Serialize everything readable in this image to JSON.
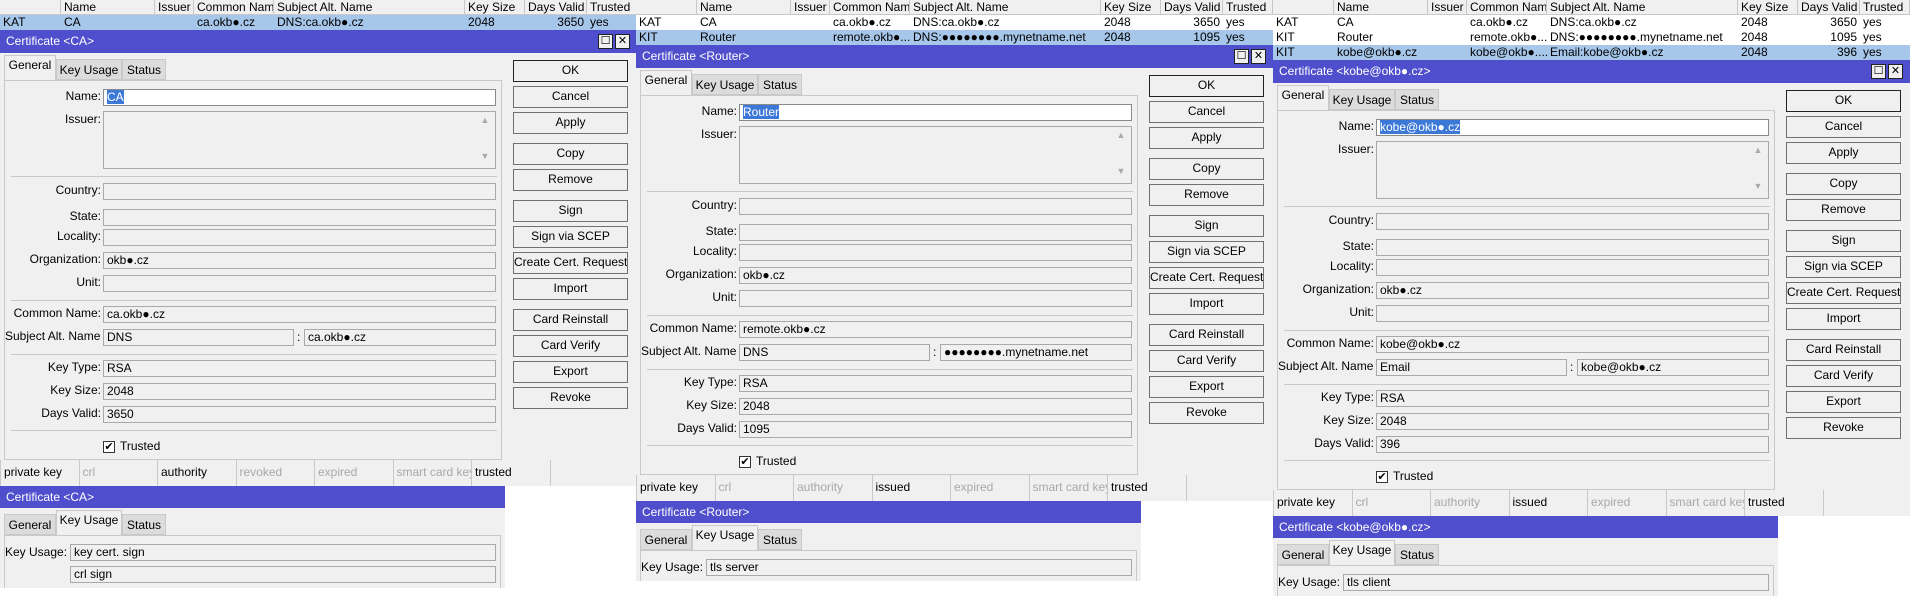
{
  "list_columns": [
    "",
    "Name",
    "Issuer",
    "Common Name",
    "Subject Alt. Name",
    "Key Size",
    "Days Valid",
    "Trusted"
  ],
  "list_rows": [
    [
      "KAT",
      "CA",
      "",
      "ca.okb●.cz",
      "DNS:ca.okb●.cz",
      "2048",
      "3650",
      "yes"
    ],
    [
      "KIT",
      "Router",
      "",
      "remote.okb●....",
      "DNS:●●●●●●●●.mynetname.net",
      "2048",
      "1095",
      "yes"
    ],
    [
      "KIT",
      "kobe@okb●.cz",
      "",
      "kobe@okb●....",
      "Email:kobe@okb●.cz",
      "2048",
      "396",
      "yes"
    ]
  ],
  "labels": {
    "name": "Name:",
    "issuer": "Issuer:",
    "country": "Country:",
    "state": "State:",
    "locality": "Locality:",
    "organization": "Organization:",
    "unit": "Unit:",
    "common_name": "Common Name:",
    "san": "Subject Alt. Name:",
    "key_type": "Key Type:",
    "key_size": "Key Size:",
    "days_valid": "Days Valid:",
    "trusted": "Trusted",
    "key_usage": "Key Usage:",
    "colon": ":"
  },
  "tabs": [
    "General",
    "Key Usage",
    "Status"
  ],
  "buttons": [
    "OK",
    "Cancel",
    "Apply",
    "Copy",
    "Remove",
    "Sign",
    "Sign via SCEP",
    "Create Cert. Request",
    "Import",
    "Card Reinstall",
    "Card Verify",
    "Export",
    "Revoke"
  ],
  "window_icons": [
    "maximize-icon",
    "close-icon"
  ],
  "colors": {
    "title_bar": "#4f4fcd",
    "selected_row": "#a6c6ea"
  },
  "panels": [
    {
      "visible_rows": 1,
      "selected_row": 0,
      "title": "Certificate <CA>",
      "active_tab": "General",
      "fields": {
        "name": "CA",
        "issuer": "",
        "country": "",
        "state": "",
        "locality": "",
        "organization": "okb●.cz",
        "unit": "",
        "common_name": "ca.okb●.cz",
        "san_type": "DNS",
        "san_value": "ca.okb●.cz",
        "key_type": "RSA",
        "key_size": "2048",
        "days_valid": "3650"
      },
      "trusted": true,
      "status_flags": [
        {
          "label": "private key",
          "active": true
        },
        {
          "label": "crl",
          "active": false
        },
        {
          "label": "authority",
          "active": true
        },
        {
          "label": "revoked",
          "active": false
        },
        {
          "label": "expired",
          "active": false
        },
        {
          "label": "smart card key",
          "active": false
        },
        {
          "label": "trusted",
          "active": true
        },
        {
          "label": "",
          "active": false
        }
      ],
      "key_usage_window": {
        "title": "Certificate <CA>",
        "active_tab": "Key Usage",
        "values": [
          "key cert. sign",
          "crl sign"
        ]
      }
    },
    {
      "visible_rows": 2,
      "selected_row": 1,
      "title": "Certificate <Router>",
      "active_tab": "General",
      "fields": {
        "name": "Router",
        "issuer": "",
        "country": "",
        "state": "",
        "locality": "",
        "organization": "okb●.cz",
        "unit": "",
        "common_name": "remote.okb●.cz",
        "san_type": "DNS",
        "san_value": "●●●●●●●●.mynetname.net",
        "key_type": "RSA",
        "key_size": "2048",
        "days_valid": "1095"
      },
      "trusted": true,
      "status_flags": [
        {
          "label": "private key",
          "active": true
        },
        {
          "label": "crl",
          "active": false
        },
        {
          "label": "authority",
          "active": false
        },
        {
          "label": "issued",
          "active": true
        },
        {
          "label": "expired",
          "active": false
        },
        {
          "label": "smart card key",
          "active": false
        },
        {
          "label": "trusted",
          "active": true
        },
        {
          "label": "",
          "active": false
        }
      ],
      "key_usage_window": {
        "title": "Certificate <Router>",
        "active_tab": "Key Usage",
        "values": [
          "tls server"
        ]
      }
    },
    {
      "visible_rows": 3,
      "selected_row": 2,
      "title": "Certificate <kobe@okb●.cz>",
      "active_tab": "General",
      "fields": {
        "name": "kobe@okb●.cz",
        "issuer": "",
        "country": "",
        "state": "",
        "locality": "",
        "organization": "okb●.cz",
        "unit": "",
        "common_name": "kobe@okb●.cz",
        "san_type": "Email",
        "san_value": "kobe@okb●.cz",
        "key_type": "RSA",
        "key_size": "2048",
        "days_valid": "396"
      },
      "trusted": true,
      "status_flags": [
        {
          "label": "private key",
          "active": true
        },
        {
          "label": "crl",
          "active": false
        },
        {
          "label": "authority",
          "active": false
        },
        {
          "label": "issued",
          "active": true
        },
        {
          "label": "expired",
          "active": false
        },
        {
          "label": "smart card key",
          "active": false
        },
        {
          "label": "trusted",
          "active": true
        },
        {
          "label": "",
          "active": false
        }
      ],
      "key_usage_window": {
        "title": "Certificate <kobe@okb●.cz>",
        "active_tab": "Key Usage",
        "values": [
          "tls client"
        ]
      }
    }
  ]
}
